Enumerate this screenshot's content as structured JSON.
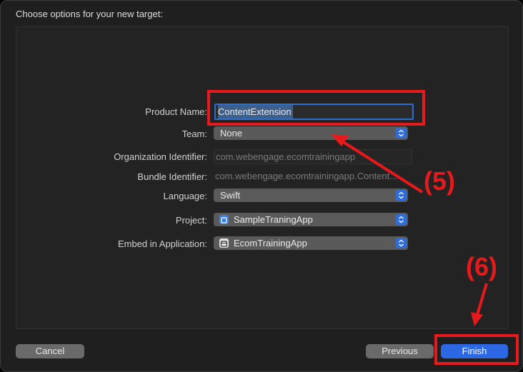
{
  "dialog": {
    "title": "Choose options for your new target:"
  },
  "form": {
    "product_name_label": "Product Name:",
    "product_name_value": "ContentExtension",
    "team_label": "Team:",
    "team_value": "None",
    "org_id_label": "Organization Identifier:",
    "org_id_value": "com.webengage.ecomtrainingapp",
    "bundle_id_label": "Bundle Identifier:",
    "bundle_id_value": "com.webengage.ecomtrainingapp.Content...",
    "language_label": "Language:",
    "language_value": "Swift",
    "project_label": "Project:",
    "project_value": "SampleTraningApp",
    "embed_label": "Embed in Application:",
    "embed_value": "EcomTrainingApp"
  },
  "buttons": {
    "cancel": "Cancel",
    "previous": "Previous",
    "finish": "Finish"
  },
  "annotations": {
    "step5": "(5)",
    "step6": "(6)",
    "color": "#e8191c"
  },
  "colors": {
    "accent": "#2c68e3",
    "window_bg": "#1f1f1f",
    "popup_bg": "#5a5a5a"
  },
  "icons": {
    "project": "xcode-project-icon",
    "app": "app-target-icon",
    "stepper": "chevron-updown-icon"
  }
}
